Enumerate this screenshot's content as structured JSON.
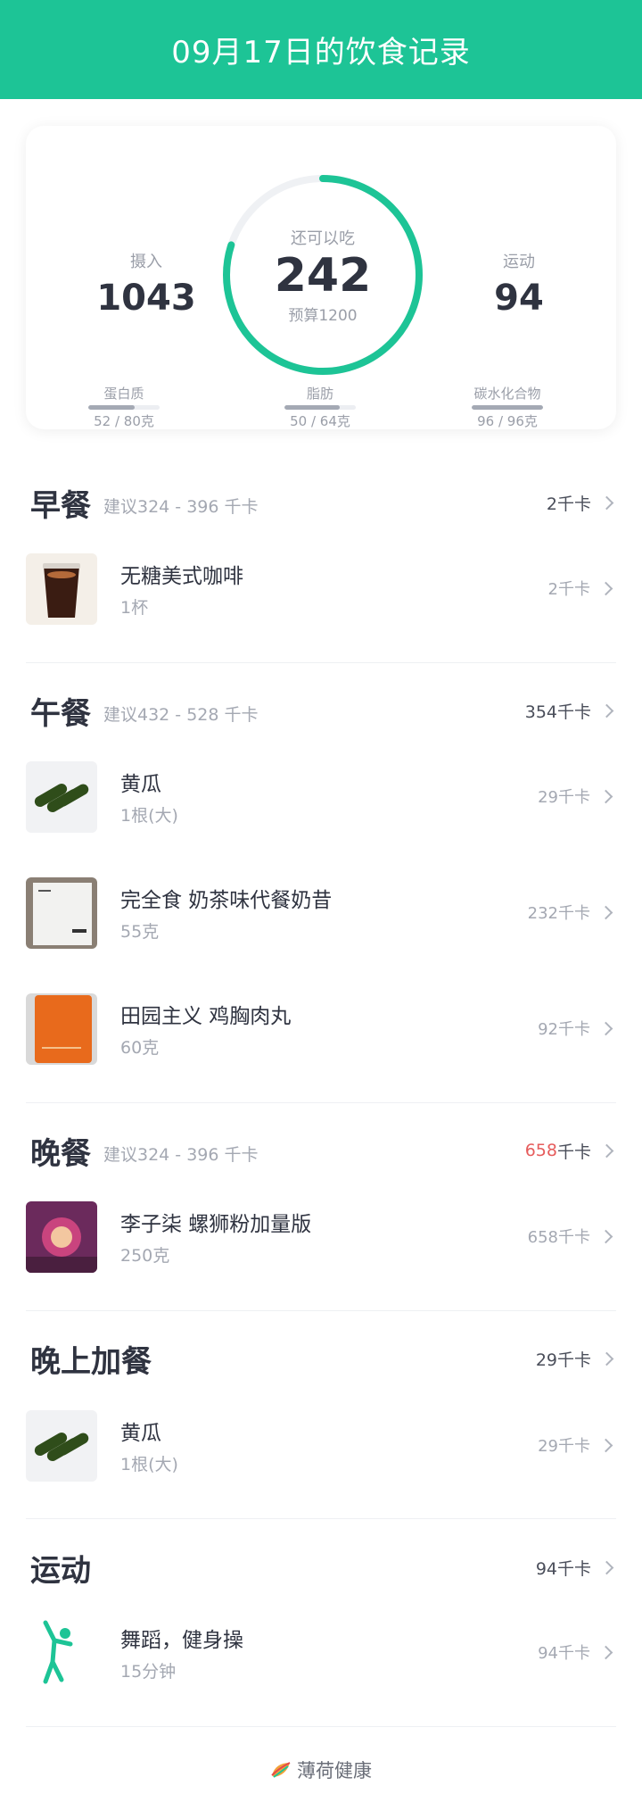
{
  "header": {
    "title": "09月17日的饮食记录"
  },
  "summary": {
    "intake": {
      "label": "摄入",
      "value": "1043"
    },
    "remaining": {
      "label": "还可以吃",
      "value": "242",
      "budget": "预算1200",
      "progress": 0.8
    },
    "exercise": {
      "label": "运动",
      "value": "94"
    },
    "macros": [
      {
        "label": "蛋白质",
        "value": "52 / 80克",
        "fraction": 0.65
      },
      {
        "label": "脂肪",
        "value": "50 / 64克",
        "fraction": 0.78
      },
      {
        "label": "碳水化合物",
        "value": "96 / 96克",
        "fraction": 1.0
      }
    ]
  },
  "sections": {
    "breakfast": {
      "title": "早餐",
      "suggestion": "建议324 - 396 千卡",
      "total": "2千卡",
      "items": [
        {
          "name": "无糖美式咖啡",
          "qty": "1杯",
          "kcal": "2千卡"
        }
      ]
    },
    "lunch": {
      "title": "午餐",
      "suggestion": "建议432 - 528 千卡",
      "total": "354千卡",
      "items": [
        {
          "name": "黄瓜",
          "qty": "1根(大)",
          "kcal": "29千卡"
        },
        {
          "name": "完全食 奶茶味代餐奶昔",
          "qty": "55克",
          "kcal": "232千卡"
        },
        {
          "name": "田园主义 鸡胸肉丸",
          "qty": "60克",
          "kcal": "92千卡"
        }
      ]
    },
    "dinner": {
      "title": "晚餐",
      "suggestion": "建议324 - 396 千卡",
      "total_num": "658",
      "total_unit": "千卡",
      "items": [
        {
          "name": "李子柒 螺狮粉加量版",
          "qty": "250克",
          "kcal": "658千卡"
        }
      ]
    },
    "snack": {
      "title": "晚上加餐",
      "total": "29千卡",
      "items": [
        {
          "name": "黄瓜",
          "qty": "1根(大)",
          "kcal": "29千卡"
        }
      ]
    },
    "exercise": {
      "title": "运动",
      "total": "94千卡",
      "items": [
        {
          "name": "舞蹈，健身操",
          "qty": "15分钟",
          "kcal": "94千卡"
        }
      ]
    }
  },
  "footer": {
    "brand": "薄荷健康"
  },
  "colors": {
    "accent": "#1dc496",
    "over": "#e65c5c"
  }
}
